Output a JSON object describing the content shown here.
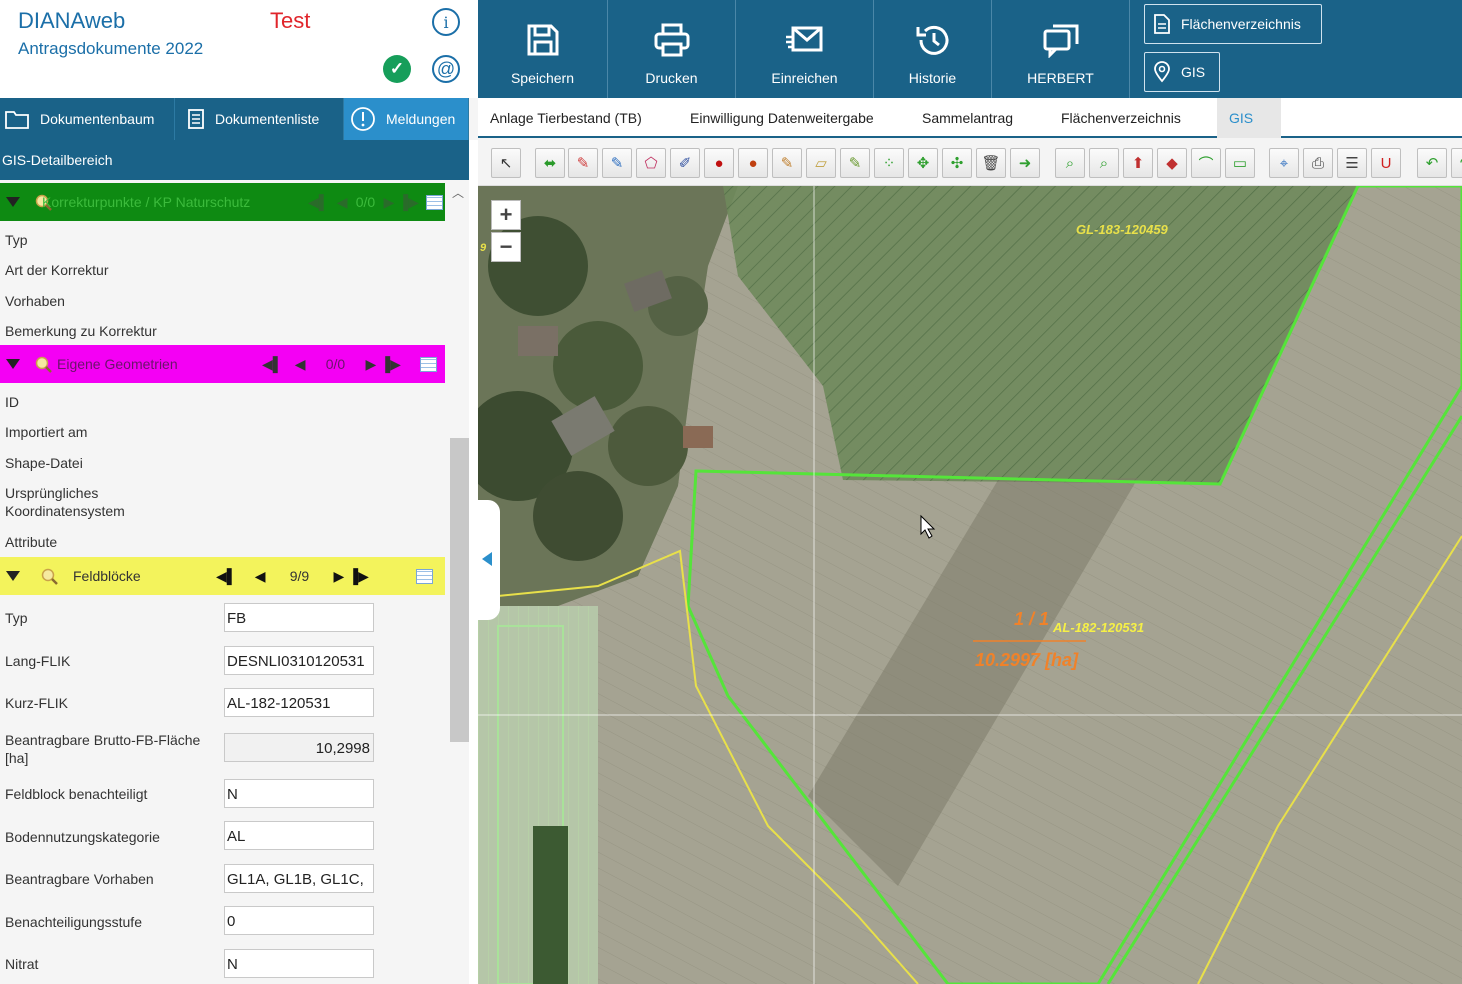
{
  "header": {
    "app_title": "DIANAweb",
    "subtitle": "Antragsdokumente 2022",
    "environment": "Test"
  },
  "nav": {
    "tabs": [
      {
        "label": "Dokumentenbaum",
        "icon": "folder-icon"
      },
      {
        "label": "Dokumentenliste",
        "icon": "document-list-icon"
      },
      {
        "label": "Meldungen",
        "icon": "alert-circle-icon",
        "active": true
      }
    ],
    "detail_title": "GIS-Detailbereich"
  },
  "sections": {
    "korrektur": {
      "title": "Korrekturpunkte / KP Naturschutz",
      "counter": "0/0",
      "color": "#0e8a12",
      "fields": [
        "Typ",
        "Art der Korrektur",
        "Vorhaben",
        "Bemerkung zu Korrektur"
      ]
    },
    "eigene": {
      "title": "Eigene Geometrien",
      "counter": "0/0",
      "color": "#f400f4",
      "fields": [
        "ID",
        "Importiert am",
        "Shape-Datei",
        "Ursprüngliches Koordinatensystem",
        "Attribute"
      ]
    },
    "feldbloecke": {
      "title": "Feldblöcke",
      "counter": "9/9",
      "color": "#f3f35c",
      "fields": [
        {
          "label": "Typ",
          "value": "FB"
        },
        {
          "label": "Lang-FLIK",
          "value": "DESNLI0310120531"
        },
        {
          "label": "Kurz-FLIK",
          "value": "AL-182-120531"
        },
        {
          "label": "Beantragbare Brutto-FB-Fläche [ha]",
          "value": "10,2998"
        },
        {
          "label": "Feldblock benachteiligt",
          "value": "N"
        },
        {
          "label": "Bodennutzungskategorie",
          "value": "AL"
        },
        {
          "label": "Beantragbare Vorhaben",
          "value": "GL1A, GL1B, GL1C,"
        },
        {
          "label": "Benachteiligungsstufe",
          "value": "0"
        },
        {
          "label": "Nitrat",
          "value": "N"
        }
      ]
    }
  },
  "toolbar_main": {
    "buttons": [
      {
        "label": "Speichern",
        "icon": "save-icon"
      },
      {
        "label": "Drucken",
        "icon": "print-icon"
      },
      {
        "label": "Einreichen",
        "icon": "send-mail-icon"
      },
      {
        "label": "Historie",
        "icon": "history-icon"
      },
      {
        "label": "HERBERT",
        "icon": "chat-icon"
      }
    ],
    "pills": [
      {
        "label": "Flächenverzeichnis",
        "icon": "document-icon"
      },
      {
        "label": "GIS",
        "icon": "location-pin-icon"
      }
    ]
  },
  "main_tabs": [
    {
      "label": "Anlage Tierbestand (TB)"
    },
    {
      "label": "Einwilligung Datenweitergabe"
    },
    {
      "label": "Sammelantrag"
    },
    {
      "label": "Flächenverzeichnis"
    },
    {
      "label": "GIS",
      "active": true
    }
  ],
  "map": {
    "labels": {
      "gl_block": "GL-183-120459",
      "al_block": "AL-182-120531",
      "fraction": "1 / 1",
      "area": "10.2997 [ha]",
      "left_edge": "9"
    },
    "zoom_in": "+",
    "zoom_out": "−",
    "colors": {
      "field_outline": "#55e43a",
      "road_line": "#e8e04a",
      "area_label": "#f0822a",
      "block_label": "#f6f046"
    }
  }
}
